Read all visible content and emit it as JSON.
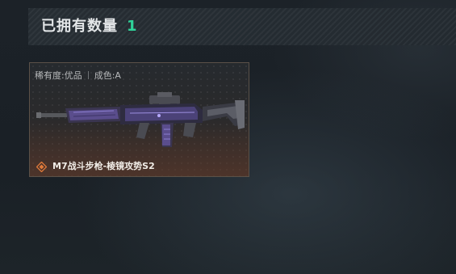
{
  "header": {
    "title": "已拥有数量",
    "count": "1"
  },
  "card": {
    "rarity": "稀有度:优品",
    "condition": "成色:A",
    "item_name": "M7战斗步枪-棱镜攻势S2",
    "rarity_icon": "diamond-emblem-icon",
    "accent_color": "#e07a3a"
  }
}
